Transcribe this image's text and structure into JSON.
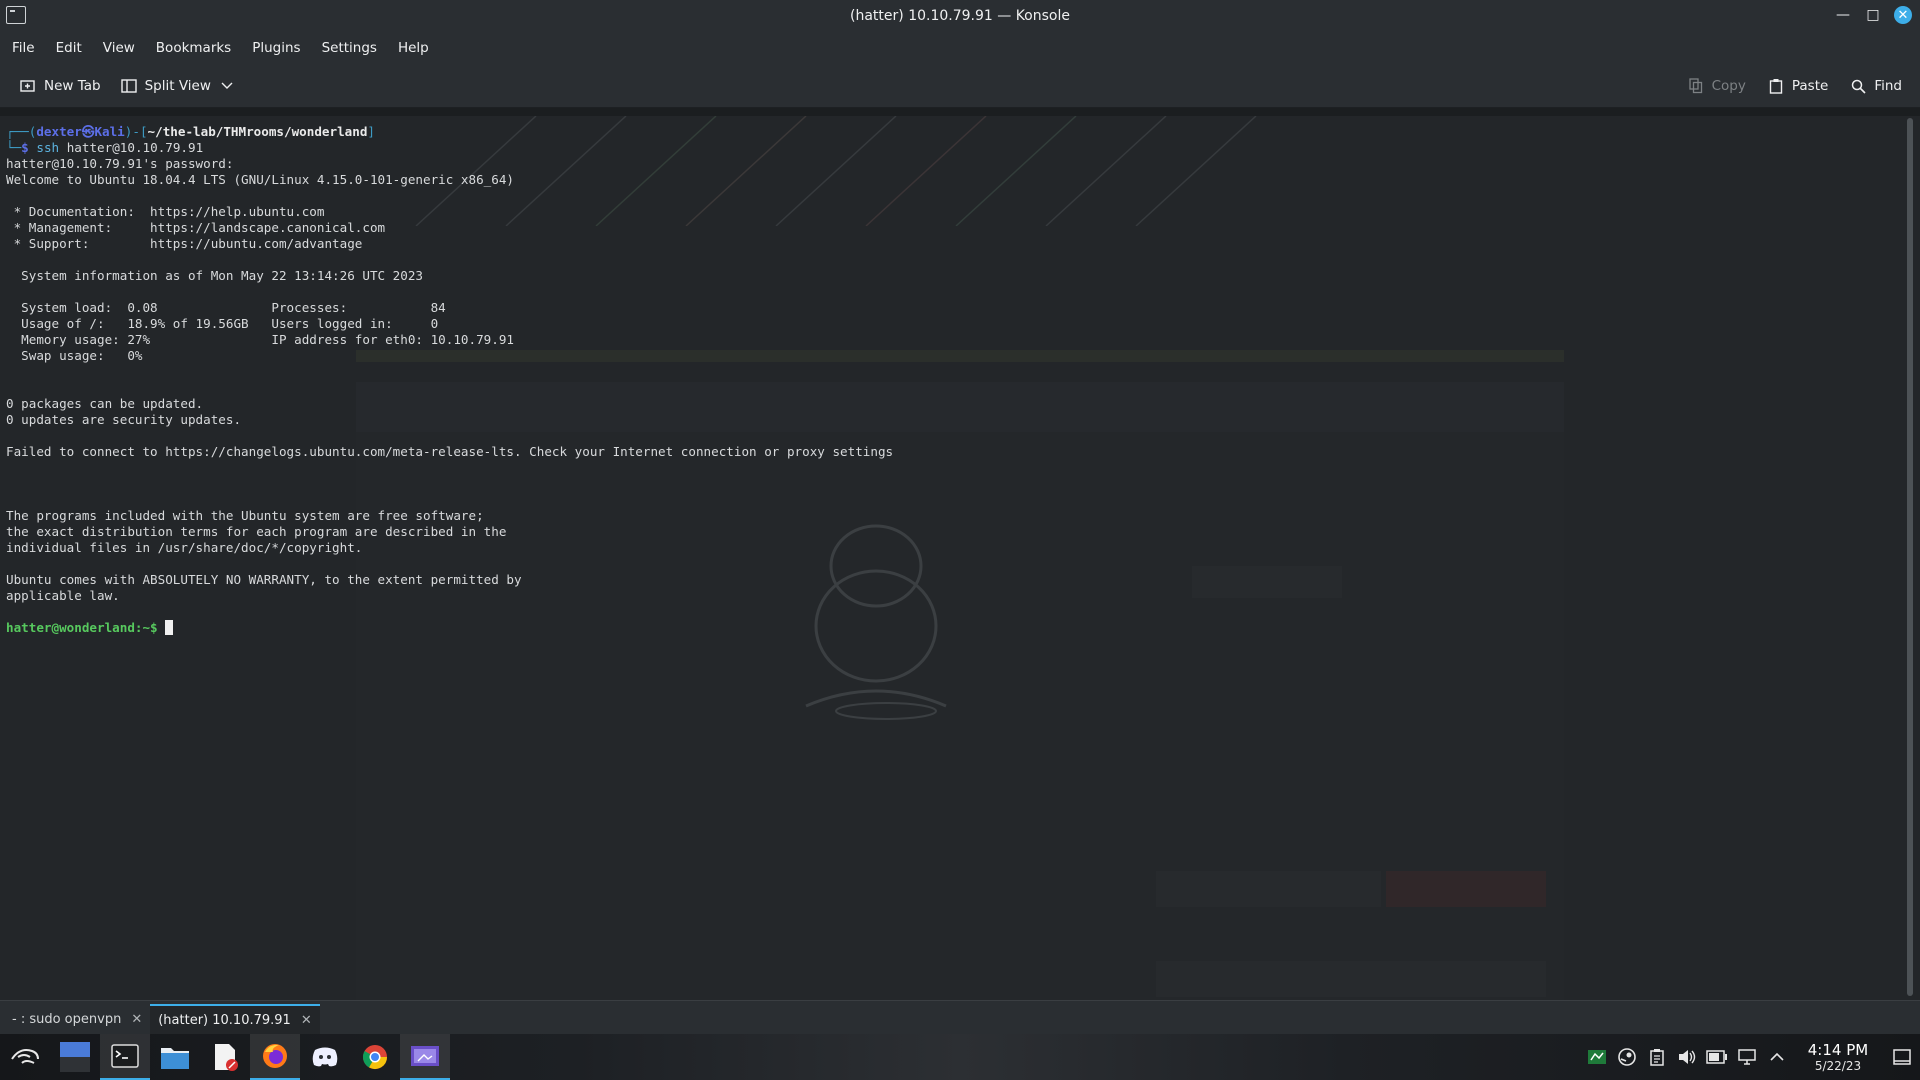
{
  "window": {
    "title": "(hatter) 10.10.79.91 — Konsole"
  },
  "menu": [
    "File",
    "Edit",
    "View",
    "Bookmarks",
    "Plugins",
    "Settings",
    "Help"
  ],
  "toolbar": {
    "new_tab": "New Tab",
    "split_view": "Split View",
    "copy": "Copy",
    "paste": "Paste",
    "find": "Find"
  },
  "terminal": {
    "prompt_user": "dexter",
    "prompt_at": "㉿",
    "prompt_host": "Kali",
    "prompt_path": "~/the-lab/THMrooms/wonderland",
    "command": "ssh hatter@10.10.79.91",
    "lines": [
      "hatter@10.10.79.91's password:",
      "Welcome to Ubuntu 18.04.4 LTS (GNU/Linux 4.15.0-101-generic x86_64)",
      "",
      " * Documentation:  https://help.ubuntu.com",
      " * Management:     https://landscape.canonical.com",
      " * Support:        https://ubuntu.com/advantage",
      "",
      "  System information as of Mon May 22 13:14:26 UTC 2023",
      "",
      "  System load:  0.08               Processes:           84",
      "  Usage of /:   18.9% of 19.56GB   Users logged in:     0",
      "  Memory usage: 27%                IP address for eth0: 10.10.79.91",
      "  Swap usage:   0%",
      "",
      "",
      "0 packages can be updated.",
      "0 updates are security updates.",
      "",
      "Failed to connect to https://changelogs.ubuntu.com/meta-release-lts. Check your Internet connection or proxy settings",
      "",
      "",
      "",
      "The programs included with the Ubuntu system are free software;",
      "the exact distribution terms for each program are described in the",
      "individual files in /usr/share/doc/*/copyright.",
      "",
      "Ubuntu comes with ABSOLUTELY NO WARRANTY, to the extent permitted by",
      "applicable law.",
      ""
    ],
    "final_prompt": "hatter@wonderland:~$ "
  },
  "tabs": [
    {
      "label": "- : sudo openvpn",
      "active": false
    },
    {
      "label": "(hatter) 10.10.79.91",
      "active": true
    }
  ],
  "taskbar": {
    "apps": [
      "kali-menu-icon",
      "desktop-pager-icon",
      "konsole-icon",
      "file-manager-icon",
      "text-editor-icon",
      "firefox-icon",
      "discord-icon",
      "chrome-icon",
      "screenshot-icon"
    ],
    "tray": [
      "network-vpn-icon",
      "steam-icon",
      "clipboard-icon",
      "volume-icon",
      "battery-icon",
      "network-icon",
      "expand-tray-icon"
    ],
    "time": "4:14 PM",
    "date": "5/22/23"
  },
  "colors": {
    "accent": "#3daee9",
    "terminal_bg": "#232629",
    "prompt_path": "#3d9bc4",
    "prompt_host": "#5c6fe8",
    "final_prompt": "#57c95e"
  }
}
